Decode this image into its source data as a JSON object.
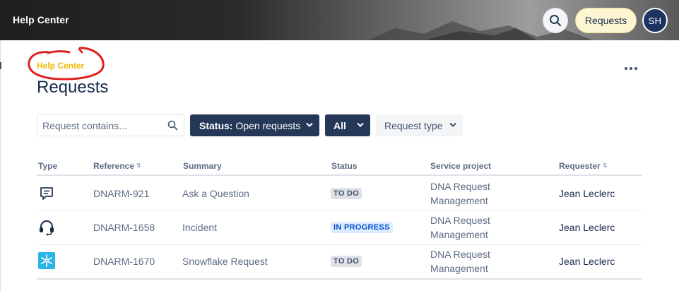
{
  "header": {
    "title": "Help Center",
    "requests_label": "Requests",
    "avatar_initials": "SH"
  },
  "breadcrumb": "Help Center",
  "page_title": "Requests",
  "filters": {
    "search_placeholder": "Request contains...",
    "status_key": "Status:",
    "status_value": "Open requests",
    "scope": "All",
    "request_type": "Request type"
  },
  "table": {
    "columns": [
      "Type",
      "Reference",
      "Summary",
      "Status",
      "Service project",
      "Requester"
    ],
    "rows": [
      {
        "type_icon": "chat-icon",
        "reference": "DNARM-921",
        "summary": "Ask a Question",
        "status": "TO DO",
        "project_line1": "DNA Request",
        "project_line2": "Management",
        "requester": "Jean Leclerc"
      },
      {
        "type_icon": "headset-icon",
        "reference": "DNARM-1658",
        "summary": "Incident",
        "status": "IN PROGRESS",
        "project_line1": "DNA Request",
        "project_line2": "Management",
        "requester": "Jean Leclerc"
      },
      {
        "type_icon": "snowflake-icon",
        "reference": "DNARM-1670",
        "summary": "Snowflake Request",
        "status": "TO DO",
        "project_line1": "DNA Request",
        "project_line2": "Management",
        "requester": "Jean Leclerc"
      }
    ]
  },
  "colors": {
    "breadcrumb": "#f2b500",
    "annotation": "#e02020",
    "primary_button": "#253858",
    "in_progress": "#0052cc"
  }
}
